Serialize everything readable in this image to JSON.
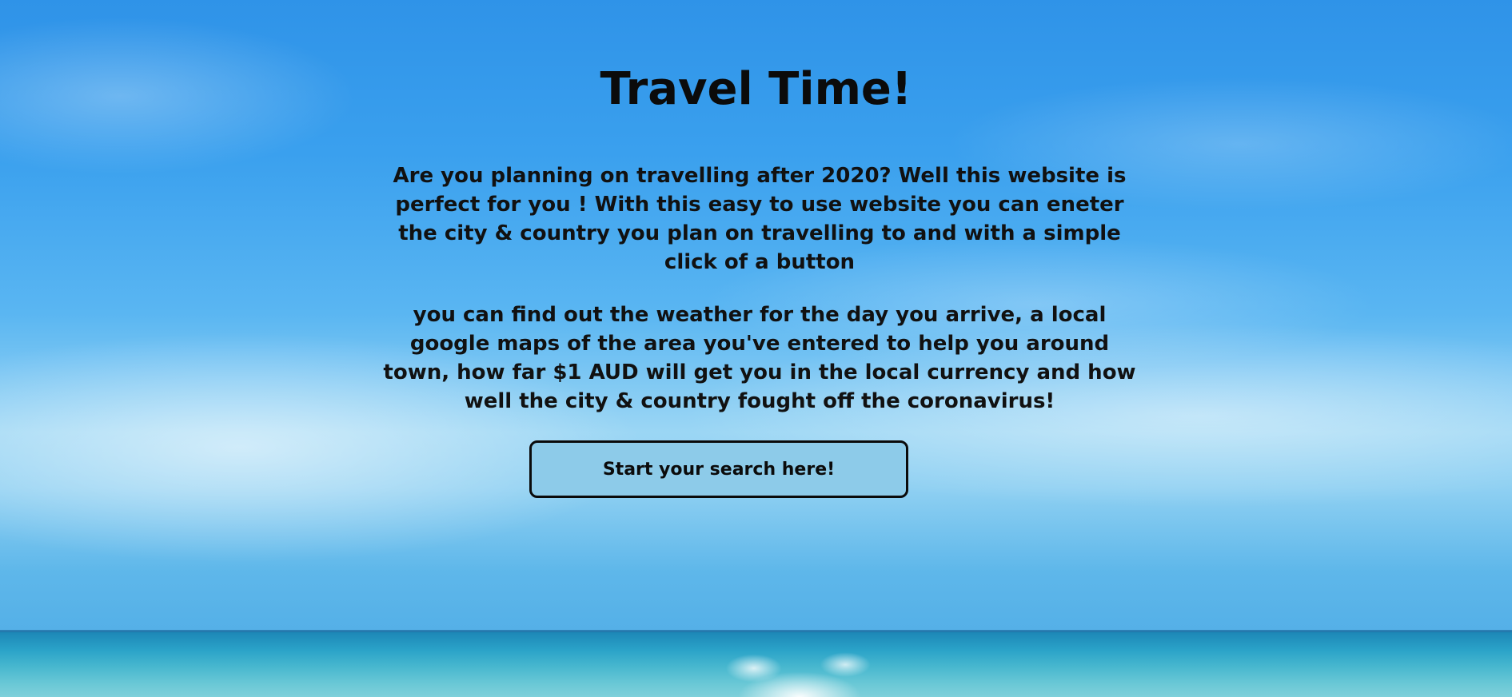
{
  "page": {
    "title": "Travel Time!",
    "intro_paragraph_1": "Are you planning on travelling after 2020? Well this website is perfect for you ! With this easy to use website you can eneter the city & country you plan on travelling to and with a simple click of a button",
    "intro_paragraph_2": "you can find out the weather for the day you arrive, a local google maps of the area you've entered to help you around town, how far $1 AUD will get you in the local currency and how well the city & country fought off the coronavirus!",
    "search_button_label": "Start your search here!"
  },
  "colors": {
    "sky_top": "#2f93e8",
    "sky_haze": "#9bd6f4",
    "sea": "#2aa2c8",
    "button_fill": "#8dcbe9",
    "button_border": "#0a0a0a",
    "text": "#0b0b0b"
  }
}
